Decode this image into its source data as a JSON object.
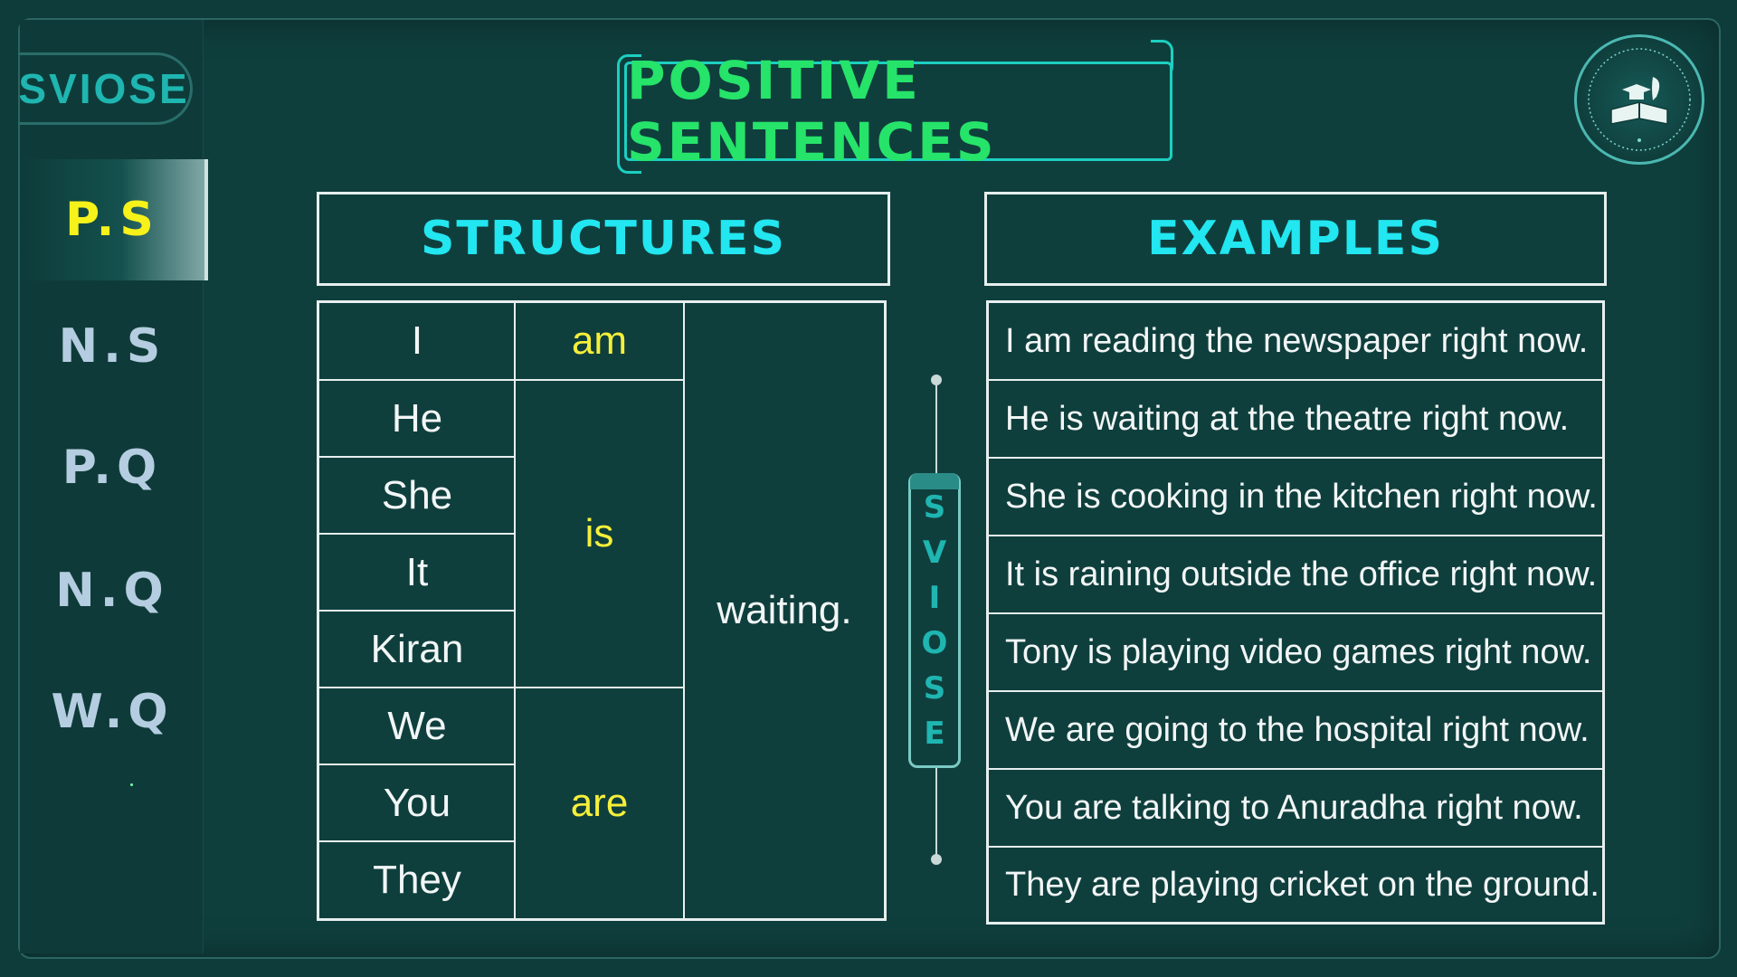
{
  "brand": "SVIOSE",
  "sidebar": {
    "items": [
      {
        "label": "P.S",
        "active": true
      },
      {
        "label": "N.S",
        "active": false
      },
      {
        "label": "P.Q",
        "active": false
      },
      {
        "label": "N.Q",
        "active": false
      },
      {
        "label": "W.Q",
        "active": false
      }
    ]
  },
  "title": "POSITIVE SENTENCES",
  "structures": {
    "header": "STRUCTURES",
    "subjects": [
      "I",
      "He",
      "She",
      "It",
      "Kiran",
      "We",
      "You",
      "They"
    ],
    "verbs": [
      "am",
      "is",
      "are"
    ],
    "ending": "waiting."
  },
  "ribbon_letters": [
    "S",
    "V",
    "I",
    "O",
    "S",
    "E"
  ],
  "examples": {
    "header": "EXAMPLES",
    "rows": [
      "I am reading the newspaper right now.",
      "He is waiting at the theatre right now.",
      "She is cooking in the kitchen right now.",
      "It is raining outside the office right now.",
      "Tony is playing video games right now.",
      "We are going to the hospital right now.",
      "You are talking to Anuradha right now.",
      "They are playing cricket on the ground."
    ]
  },
  "colors": {
    "background": "#0f3f3d",
    "title_green": "#26e36a",
    "header_cyan": "#22e6f0",
    "active_yellow": "#f7f21a",
    "verb_yellow": "#f6ef3a",
    "nav_inactive": "#b5cde0"
  },
  "logo": {
    "icon": "book-graduation-cap-icon"
  }
}
